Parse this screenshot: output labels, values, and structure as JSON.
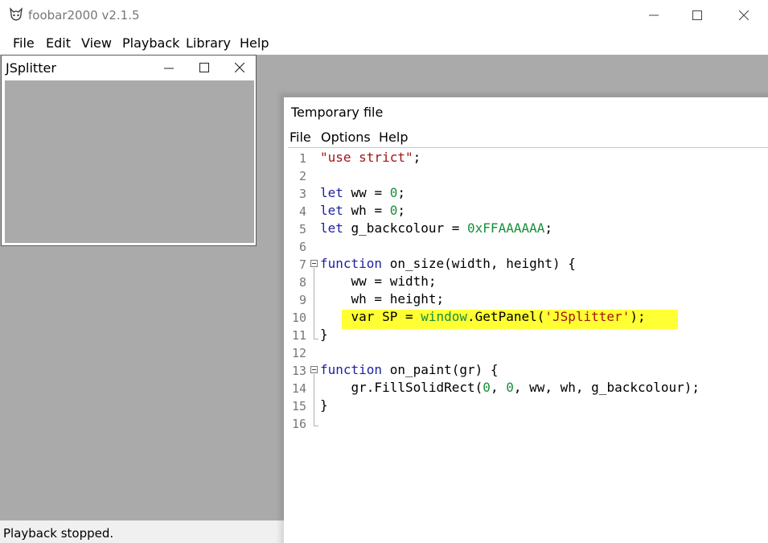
{
  "app": {
    "title": "foobar2000 v2.1.5",
    "icon": "foobar-cat-icon"
  },
  "main_menu": [
    "File",
    "Edit",
    "View",
    "Playback",
    "Library",
    "Help"
  ],
  "status_bar": {
    "text": "Playback stopped."
  },
  "jsplitter_window": {
    "title": "JSplitter",
    "client_color": "#aaaaaa"
  },
  "editor_window": {
    "title": "Temporary file",
    "menu": [
      "File",
      "Options",
      "Help"
    ],
    "highlighted_line": 10,
    "highlight_color": "#ffff33",
    "lines": [
      {
        "n": "1",
        "tokens": [
          {
            "t": "\"use strict\"",
            "c": "str"
          },
          {
            "t": ";",
            "c": "plain"
          }
        ]
      },
      {
        "n": "2",
        "tokens": []
      },
      {
        "n": "3",
        "tokens": [
          {
            "t": "let",
            "c": "kw"
          },
          {
            "t": " ww = ",
            "c": "plain"
          },
          {
            "t": "0",
            "c": "num"
          },
          {
            "t": ";",
            "c": "plain"
          }
        ]
      },
      {
        "n": "4",
        "tokens": [
          {
            "t": "let",
            "c": "kw"
          },
          {
            "t": " wh = ",
            "c": "plain"
          },
          {
            "t": "0",
            "c": "num"
          },
          {
            "t": ";",
            "c": "plain"
          }
        ]
      },
      {
        "n": "5",
        "tokens": [
          {
            "t": "let",
            "c": "kw"
          },
          {
            "t": " g_backcolour = ",
            "c": "plain"
          },
          {
            "t": "0xFFAAAAAA",
            "c": "num"
          },
          {
            "t": ";",
            "c": "plain"
          }
        ]
      },
      {
        "n": "6",
        "tokens": []
      },
      {
        "n": "7",
        "tokens": [
          {
            "t": "function",
            "c": "kw"
          },
          {
            "t": " on_size(width, height) {",
            "c": "plain"
          }
        ]
      },
      {
        "n": "8",
        "tokens": [
          {
            "t": "    ww = width;",
            "c": "plain"
          }
        ]
      },
      {
        "n": "9",
        "tokens": [
          {
            "t": "    wh = height;",
            "c": "plain"
          }
        ]
      },
      {
        "n": "10",
        "tokens": [
          {
            "t": "    var SP = ",
            "c": "plain"
          },
          {
            "t": "window",
            "c": "num"
          },
          {
            "t": ".GetPanel(",
            "c": "plain"
          },
          {
            "t": "'JSplitter'",
            "c": "str"
          },
          {
            "t": ");",
            "c": "plain"
          }
        ]
      },
      {
        "n": "11",
        "tokens": [
          {
            "t": "}",
            "c": "plain"
          }
        ]
      },
      {
        "n": "12",
        "tokens": []
      },
      {
        "n": "13",
        "tokens": [
          {
            "t": "function",
            "c": "kw"
          },
          {
            "t": " on_paint(gr) {",
            "c": "plain"
          }
        ]
      },
      {
        "n": "14",
        "tokens": [
          {
            "t": "    gr.FillSolidRect(",
            "c": "plain"
          },
          {
            "t": "0",
            "c": "num"
          },
          {
            "t": ", ",
            "c": "plain"
          },
          {
            "t": "0",
            "c": "num"
          },
          {
            "t": ", ww, wh, g_backcolour);",
            "c": "plain"
          }
        ]
      },
      {
        "n": "15",
        "tokens": [
          {
            "t": "}",
            "c": "plain"
          }
        ]
      },
      {
        "n": "16",
        "tokens": []
      }
    ]
  },
  "icons": {
    "minimize": "minimize-icon",
    "maximize": "maximize-icon",
    "close": "close-icon",
    "fold": "fold-minus-icon"
  }
}
